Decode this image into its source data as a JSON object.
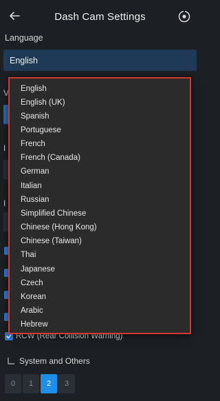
{
  "header": {
    "title": "Dash Cam Settings"
  },
  "language_section": {
    "label": "Language",
    "selected": "English"
  },
  "dropdown": {
    "options": [
      "English",
      "English (UK)",
      "Spanish",
      "Portuguese",
      "French",
      "French (Canada)",
      "German",
      "Italian",
      "Russian",
      "Simplified Chinese",
      "Chinese (Hong Kong)",
      "Chinese (Taiwan)",
      "Thai",
      "Japanese",
      "Czech",
      "Korean",
      "Arabic",
      "Hebrew"
    ]
  },
  "rcw": {
    "label": "RCW (Rear Collision Warning)"
  },
  "system": {
    "label": "System and Others"
  },
  "pagination": {
    "pages": [
      "0",
      "1",
      "2",
      "3"
    ],
    "active_index": 2
  },
  "colors": {
    "background": "#1c1f24",
    "accent": "#1e8ee6",
    "dropdown_border": "#d2382f"
  }
}
